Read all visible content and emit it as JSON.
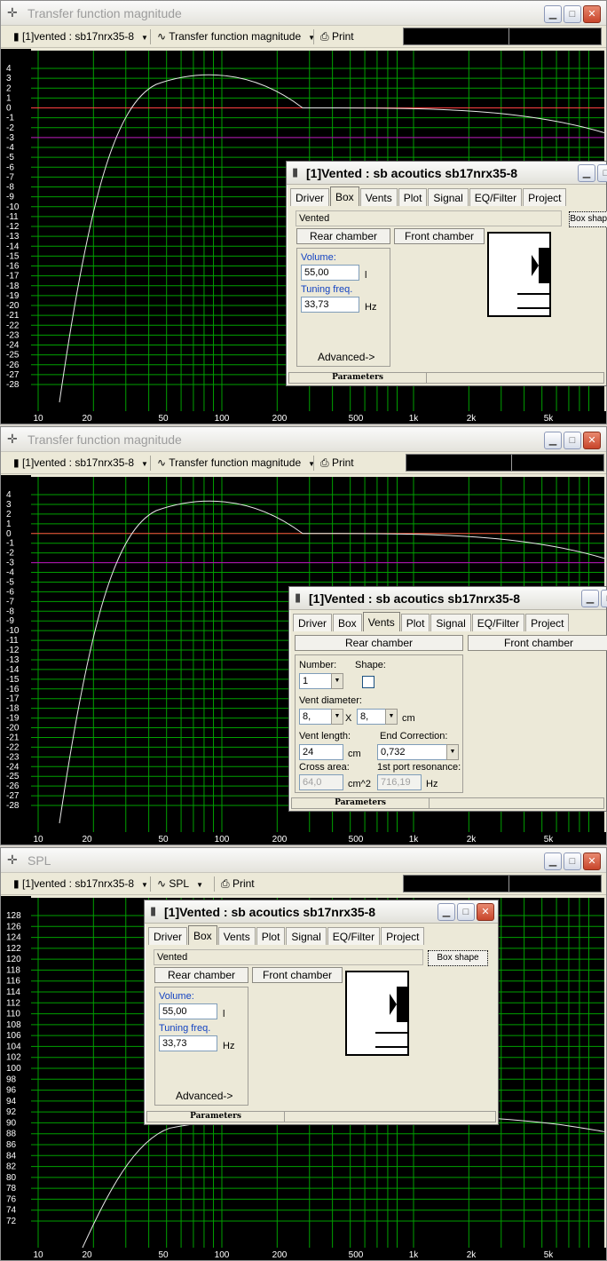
{
  "windows": [
    {
      "title": "Transfer function magnitude",
      "toolbar": {
        "project": "[1]vented : sb17nrx35-8",
        "graph": "Transfer function magnitude",
        "print": "Print"
      },
      "y_ticks": [
        "4",
        "3",
        "2",
        "1",
        "0",
        "-1",
        "-2",
        "-3",
        "-4",
        "-5",
        "-6",
        "-7",
        "-8",
        "-9",
        "-10",
        "-11",
        "-12",
        "-13",
        "-14",
        "-15",
        "-16",
        "-17",
        "-18",
        "-19",
        "-20",
        "-21",
        "-22",
        "-23",
        "-24",
        "-25",
        "-26",
        "-27",
        "-28"
      ],
      "x_ticks": [
        "10",
        "20",
        "50",
        "100",
        "200",
        "500",
        "1k",
        "2k",
        "5k"
      ]
    },
    {
      "title": "Transfer function magnitude",
      "toolbar": {
        "project": "[1]vented : sb17nrx35-8",
        "graph": "Transfer function magnitude",
        "print": "Print"
      },
      "y_ticks": [
        "4",
        "3",
        "2",
        "1",
        "0",
        "-1",
        "-2",
        "-3",
        "-4",
        "-5",
        "-6",
        "-7",
        "-8",
        "-9",
        "-10",
        "-11",
        "-12",
        "-13",
        "-14",
        "-15",
        "-16",
        "-17",
        "-18",
        "-19",
        "-20",
        "-21",
        "-22",
        "-23",
        "-24",
        "-25",
        "-26",
        "-27",
        "-28"
      ],
      "x_ticks": [
        "10",
        "20",
        "50",
        "100",
        "200",
        "500",
        "1k",
        "2k",
        "5k"
      ]
    },
    {
      "title": "SPL",
      "toolbar": {
        "project": "[1]vented : sb17nrx35-8",
        "graph": "SPL",
        "print": "Print"
      },
      "y_ticks": [
        "128",
        "126",
        "124",
        "122",
        "120",
        "118",
        "116",
        "114",
        "112",
        "110",
        "108",
        "106",
        "104",
        "102",
        "100",
        "98",
        "96",
        "94",
        "92",
        "90",
        "88",
        "86",
        "84",
        "82",
        "80",
        "78",
        "76",
        "74",
        "72"
      ],
      "x_ticks": [
        "10",
        "20",
        "50",
        "100",
        "200",
        "500",
        "1k",
        "2k",
        "5k"
      ]
    }
  ],
  "dialog": {
    "title": "[1]Vented : sb acoutics sb17nrx35-8",
    "tabs": [
      "Driver",
      "Box",
      "Vents",
      "Plot",
      "Signal",
      "EQ/Filter",
      "Project"
    ],
    "box_tab": {
      "box_type": "Vented",
      "box_shape_button": "Box shape",
      "rear_chamber": "Rear chamber",
      "front_chamber": "Front chamber",
      "volume_label": "Volume:",
      "volume_value": "55,00",
      "volume_unit": "l",
      "tuning_label": "Tuning freq.",
      "tuning_value": "33,73",
      "tuning_unit": "Hz",
      "advanced": "Advanced->"
    },
    "vents_tab": {
      "rear_chamber": "Rear chamber",
      "front_chamber": "Front chamber",
      "number_label": "Number:",
      "number_value": "1",
      "shape_label": "Shape:",
      "vent_diameter_label": "Vent diameter:",
      "diam1": "8,",
      "times": "X",
      "diam2": "8,",
      "diam_unit": "cm",
      "vent_length_label": "Vent length:",
      "vent_length_value": "24",
      "vent_length_unit": "cm",
      "end_correction_label": "End Correction:",
      "end_correction_value": "0,732",
      "cross_area_label": "Cross area:",
      "cross_area_value": "64,0",
      "cross_area_unit": "cm^2",
      "port_res_label": "1st port resonance:",
      "port_res_value": "716,19",
      "port_res_unit": "Hz"
    },
    "status": "Parameters"
  },
  "colors": {
    "plot_bg": "#000000",
    "grid": "#00a000",
    "curve": "#e8e8e8",
    "ref_line_0db": "#ff4040",
    "ref_line_3db": "#c000c0"
  }
}
